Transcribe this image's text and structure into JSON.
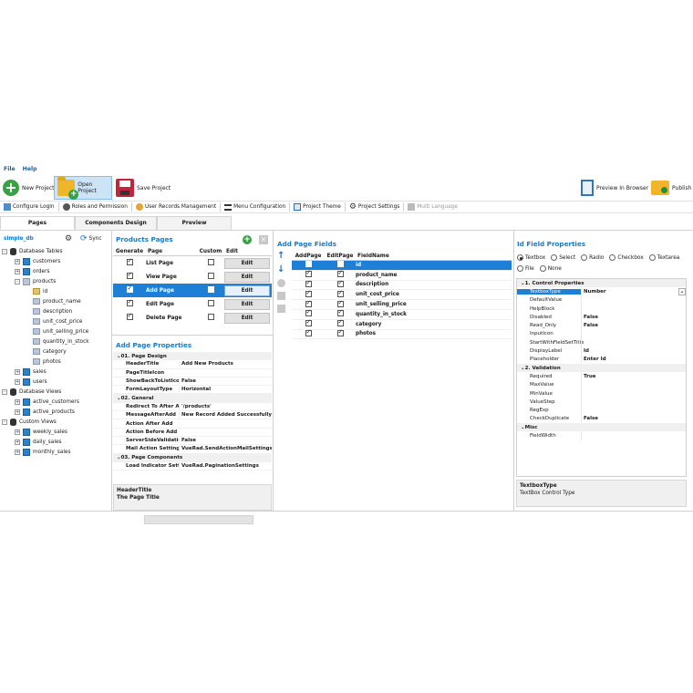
{
  "menu": {
    "file": "File",
    "help": "Help"
  },
  "toolbar": {
    "new_project": "New Project",
    "open_project": "Open Project",
    "save_project": "Save Project",
    "preview": "Preview In Browser",
    "publish": "Publish"
  },
  "secondary_toolbar": {
    "configure_login": "Configure Login",
    "roles": "Roles and Permission",
    "user_records": "User Records Management",
    "menu_config": "Menu Configuration",
    "project_theme": "Project Theme",
    "project_settings": "Project Settings",
    "multi_language": "Multi Language"
  },
  "tabs": {
    "pages": "Pages",
    "components": "Components Design",
    "preview": "Preview"
  },
  "db": {
    "name": "simple_db",
    "sync": "Sync",
    "tables_label": "Database Tables",
    "tables": [
      "customers",
      "orders",
      "products"
    ],
    "product_fields": [
      "id",
      "product_name",
      "description",
      "unit_cost_price",
      "unit_selling_price",
      "quantity_in_stock",
      "category",
      "photos"
    ],
    "tables_after": [
      "sales",
      "users"
    ],
    "views_label": "Database Views",
    "views": [
      "active_customers",
      "active_products"
    ],
    "custom_label": "Custom Views",
    "custom": [
      "weekly_sales",
      "daily_sales",
      "monthly_sales"
    ]
  },
  "products_pages": {
    "title": "Products Pages",
    "headers": {
      "generate": "Generate",
      "page": "Page",
      "custom": "Custom",
      "edit": "Edit"
    },
    "rows": [
      {
        "page": "List Page",
        "edit": "Edit"
      },
      {
        "page": "View Page",
        "edit": "Edit"
      },
      {
        "page": "Add Page",
        "edit": "Edit"
      },
      {
        "page": "Edit Page",
        "edit": "Edit"
      },
      {
        "page": "Delete Page",
        "edit": "Edit"
      }
    ]
  },
  "add_page_props": {
    "title": "Add Page Properties",
    "cat1": "01. Page Design",
    "design": [
      {
        "k": "HeaderTitle",
        "v": "Add New Products"
      },
      {
        "k": "PageTitleIcon",
        "v": ""
      },
      {
        "k": "ShowBackToListIcon",
        "v": "False"
      },
      {
        "k": "FormLayoutType",
        "v": "Horizontal"
      }
    ],
    "cat2": "02. General",
    "general": [
      {
        "k": "Redirect To After Add",
        "v": "'/products'"
      },
      {
        "k": "MessageAfterAdd",
        "v": "New Record Added Successfully"
      },
      {
        "k": "Action After Add",
        "v": ""
      },
      {
        "k": "Action Before Add",
        "v": ""
      },
      {
        "k": "ServerSideValidation",
        "v": "False"
      },
      {
        "k": "Mail Action Settings",
        "v": "VueRad.SendActionMailSettings"
      }
    ],
    "cat3": "03. Page Components",
    "components": [
      {
        "k": "Load Indicator Settings",
        "v": "VueRad.PaginationSettings"
      }
    ],
    "desc_title": "HeaderTitle",
    "desc_text": "The Page Title"
  },
  "add_page_fields": {
    "title": "Add Page Fields",
    "headers": {
      "add": "AddPage",
      "edit": "EditPage",
      "field": "FieldName"
    },
    "rows": [
      "id",
      "product_name",
      "description",
      "unit_cost_price",
      "unit_selling_price",
      "quantity_in_stock",
      "category",
      "photos"
    ]
  },
  "field_props": {
    "title": "Id Field Properties",
    "radios": [
      "Textbox",
      "Select",
      "Radio",
      "Checkbox",
      "Textarea",
      "File",
      "None"
    ],
    "cat1": "1. Control Properties",
    "control": [
      {
        "k": "TextboxType",
        "v": "Number"
      },
      {
        "k": "DefaultValue",
        "v": ""
      },
      {
        "k": "HelpBlock",
        "v": ""
      },
      {
        "k": "Disabled",
        "v": "False"
      },
      {
        "k": "Read_Only",
        "v": "False"
      },
      {
        "k": "InputIcon",
        "v": ""
      },
      {
        "k": "StartWithFieldSetTitle",
        "v": ""
      },
      {
        "k": "DisplayLabel",
        "v": "Id"
      },
      {
        "k": "Placeholder",
        "v": "Enter Id"
      }
    ],
    "cat2": "2. Validation",
    "validation": [
      {
        "k": "Required",
        "v": "True"
      },
      {
        "k": "MaxValue",
        "v": ""
      },
      {
        "k": "MinValue",
        "v": ""
      },
      {
        "k": "ValueStep",
        "v": ""
      },
      {
        "k": "RegExp",
        "v": ""
      },
      {
        "k": "CheckDuplicate",
        "v": "False"
      }
    ],
    "cat3": "Misc",
    "misc": [
      {
        "k": "FieldWidth",
        "v": ""
      }
    ],
    "desc_title": "TextboxType",
    "desc_text": "TextBox Control Type"
  },
  "colors": {
    "accent": "#1e7fd6",
    "title": "#1a7ac9",
    "green": "#3aa046"
  }
}
